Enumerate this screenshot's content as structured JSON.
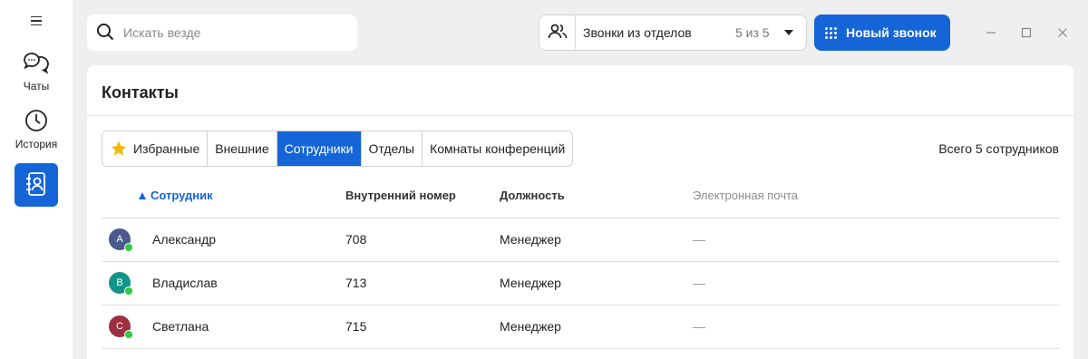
{
  "sidebar": {
    "items": [
      {
        "label": "Чаты"
      },
      {
        "label": "История"
      }
    ]
  },
  "search": {
    "placeholder": "Искать везде",
    "value": ""
  },
  "calls_filter": {
    "label": "Звонки из отделов",
    "count": "5 из 5"
  },
  "new_call": {
    "label": "Новый звонок"
  },
  "colors": {
    "accent": "#1565d8",
    "online": "#2ecc40"
  },
  "panel": {
    "title": "Контакты",
    "tabs": [
      {
        "label": "Избранные"
      },
      {
        "label": "Внешние"
      },
      {
        "label": "Сотрудники"
      },
      {
        "label": "Отделы"
      },
      {
        "label": "Комнаты конференций"
      }
    ],
    "active_tab": "Сотрудники",
    "total": "Всего 5 сотрудников"
  },
  "table": {
    "headers": {
      "employee": "Сотрудник",
      "ext": "Внутренний номер",
      "position": "Должность",
      "email": "Электронная почта"
    },
    "rows": [
      {
        "initial": "А",
        "name": "Александр",
        "ext": "708",
        "position": "Менеджер",
        "email": "—",
        "avatar_color": "#4a5a8c"
      },
      {
        "initial": "В",
        "name": "Владислав",
        "ext": "713",
        "position": "Менеджер",
        "email": "—",
        "avatar_color": "#13948a"
      },
      {
        "initial": "С",
        "name": "Светлана",
        "ext": "715",
        "position": "Менеджер",
        "email": "—",
        "avatar_color": "#9a3040"
      }
    ]
  }
}
